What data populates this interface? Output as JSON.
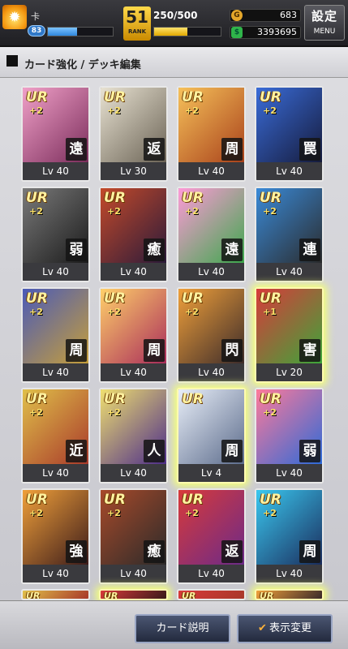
{
  "header": {
    "player_name": "卡",
    "player_level": "83",
    "exp_progress": 0.45,
    "rank_number": "51",
    "rank_label": "RANK",
    "stamina": "250/500",
    "stamina_progress": 0.5,
    "gold": "683",
    "cash": "3393695",
    "menu_kanji": "設定",
    "menu_label": "MENU"
  },
  "title": "カード強化 / デッキ編集",
  "cards": [
    {
      "rarity": "UR",
      "plus": "+2",
      "skill": "遠",
      "level": "Lv 40",
      "art": [
        "#f0a0c8",
        "#7a2c5a"
      ]
    },
    {
      "rarity": "UR",
      "plus": "+2",
      "skill": "返",
      "level": "Lv 30",
      "art": [
        "#e8e2d2",
        "#6a6254"
      ]
    },
    {
      "rarity": "UR",
      "plus": "+2",
      "skill": "周",
      "level": "Lv 40",
      "art": [
        "#f6c15a",
        "#a8401a"
      ]
    },
    {
      "rarity": "UR",
      "plus": "+2",
      "skill": "罠",
      "level": "Lv 40",
      "art": [
        "#3a6cd8",
        "#151a3a"
      ]
    },
    {
      "rarity": "UR",
      "plus": "+2",
      "skill": "弱",
      "level": "Lv 40",
      "art": [
        "#7a7a7a",
        "#1a1a1a"
      ]
    },
    {
      "rarity": "UR",
      "plus": "+2",
      "skill": "癒",
      "level": "Lv 40",
      "art": [
        "#c44a2a",
        "#2a1a3a"
      ]
    },
    {
      "rarity": "UR",
      "plus": "+2",
      "skill": "遠",
      "level": "Lv 40",
      "art": [
        "#ff9ad8",
        "#3aa84a"
      ]
    },
    {
      "rarity": "UR",
      "plus": "+2",
      "skill": "連",
      "level": "Lv 40",
      "art": [
        "#3a8ad8",
        "#2a2a2a"
      ]
    },
    {
      "rarity": "UR",
      "plus": "+2",
      "skill": "周",
      "level": "Lv 40",
      "art": [
        "#4a5ab8",
        "#c8a038"
      ]
    },
    {
      "rarity": "UR",
      "plus": "+2",
      "skill": "周",
      "level": "Lv 40",
      "art": [
        "#ffd06a",
        "#a82a5a"
      ]
    },
    {
      "rarity": "UR",
      "plus": "+2",
      "skill": "閃",
      "level": "Lv 40",
      "art": [
        "#f0a03a",
        "#3a2a2a"
      ]
    },
    {
      "rarity": "UR",
      "plus": "+1",
      "skill": "害",
      "level": "Lv 20",
      "art": [
        "#d83a3a",
        "#3aa83a"
      ],
      "glow": true
    },
    {
      "rarity": "UR",
      "plus": "+2",
      "skill": "近",
      "level": "Lv 40",
      "art": [
        "#e0c04a",
        "#a8382a"
      ]
    },
    {
      "rarity": "UR",
      "plus": "+2",
      "skill": "人",
      "level": "Lv 40",
      "art": [
        "#f0e070",
        "#4a2a8a"
      ]
    },
    {
      "rarity": "UR",
      "plus": "",
      "skill": "周",
      "level": "Lv 4",
      "art": [
        "#e8eef8",
        "#5a6a8a"
      ],
      "glow": true
    },
    {
      "rarity": "UR",
      "plus": "+2",
      "skill": "弱",
      "level": "Lv 40",
      "art": [
        "#ff7a9a",
        "#2a6ad8"
      ]
    },
    {
      "rarity": "UR",
      "plus": "+2",
      "skill": "強",
      "level": "Lv 40",
      "art": [
        "#f0a03a",
        "#3a1a1a"
      ]
    },
    {
      "rarity": "UR",
      "plus": "+2",
      "skill": "癒",
      "level": "Lv 40",
      "art": [
        "#a84a2a",
        "#2a2a2a"
      ]
    },
    {
      "rarity": "UR",
      "plus": "+2",
      "skill": "返",
      "level": "Lv 40",
      "art": [
        "#d83a3a",
        "#6a2a8a"
      ]
    },
    {
      "rarity": "UR",
      "plus": "+2",
      "skill": "周",
      "level": "Lv 40",
      "art": [
        "#3ac8f0",
        "#1a2a5a"
      ]
    }
  ],
  "partial_cards": [
    {
      "rarity": "UR",
      "art": [
        "#e0c04a",
        "#a8382a"
      ]
    },
    {
      "rarity": "UR",
      "art": [
        "#d83a3a",
        "#3a1a1a"
      ],
      "glow": true
    },
    {
      "rarity": "UR",
      "art": [
        "#d83a3a",
        "#a8382a"
      ]
    },
    {
      "rarity": "UR",
      "art": [
        "#f0a03a",
        "#3a2a2a"
      ],
      "glow": true
    }
  ],
  "buttons": {
    "card_description": "カード説明",
    "display_change": "表示変更",
    "display_check": "✔"
  }
}
